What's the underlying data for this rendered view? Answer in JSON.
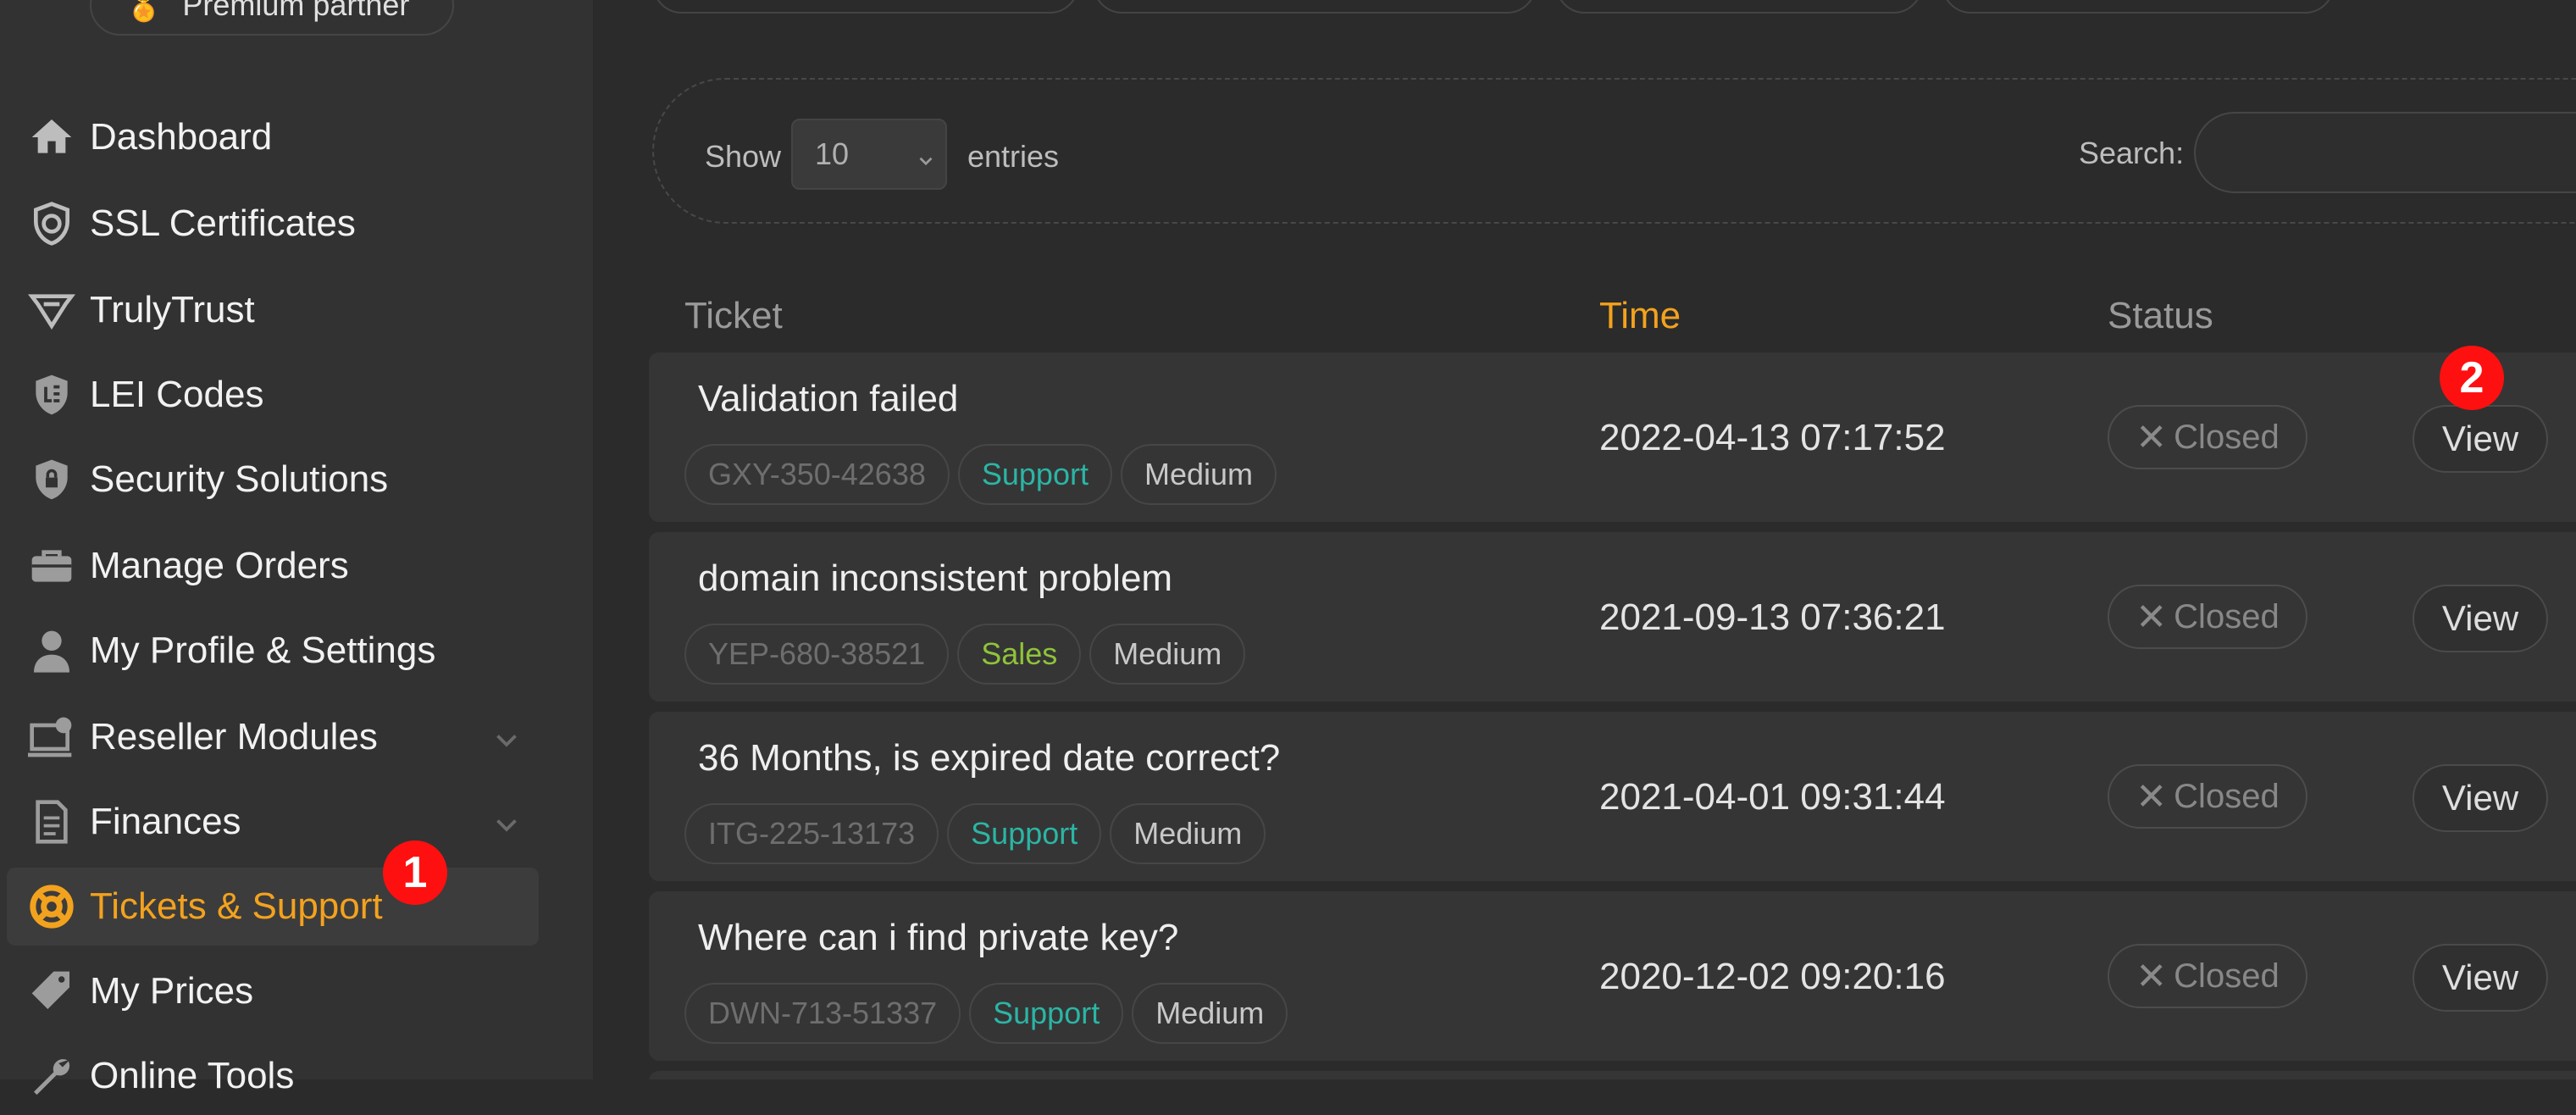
{
  "sidebar": {
    "partner_badge": "Premium partner",
    "items": [
      {
        "label": "Dashboard",
        "icon": "home-icon"
      },
      {
        "label": "SSL Certificates",
        "icon": "ssl-shield-icon"
      },
      {
        "label": "TrulyTrust",
        "icon": "trulytrust-icon"
      },
      {
        "label": "LEI Codes",
        "icon": "lei-shield-icon"
      },
      {
        "label": "Security Solutions",
        "icon": "lock-shield-icon"
      },
      {
        "label": "Manage Orders",
        "icon": "briefcase-icon"
      },
      {
        "label": "My Profile & Settings",
        "icon": "user-icon"
      },
      {
        "label": "Reseller Modules",
        "icon": "modules-icon",
        "expandable": true
      },
      {
        "label": "Finances",
        "icon": "document-icon",
        "expandable": true
      },
      {
        "label": "Tickets & Support",
        "icon": "lifebuoy-icon",
        "active": true
      },
      {
        "label": "My Prices",
        "icon": "price-tag-icon"
      },
      {
        "label": "Online Tools",
        "icon": "wrench-icon"
      }
    ]
  },
  "markers": [
    "1",
    "2"
  ],
  "table_controls": {
    "show_label": "Show",
    "entries_value": "10",
    "entries_label": "entries",
    "search_label": "Search:",
    "search_value": ""
  },
  "columns": {
    "ticket": "Ticket",
    "time": "Time",
    "status": "Status"
  },
  "tickets": [
    {
      "title": "Validation failed",
      "code": "GXY-350-42638",
      "department": "Support",
      "priority": "Medium",
      "time": "2022-04-13 07:17:52",
      "status": "Closed",
      "action": "View"
    },
    {
      "title": "domain inconsistent problem",
      "code": "YEP-680-38521",
      "department": "Sales",
      "priority": "Medium",
      "time": "2021-09-13 07:36:21",
      "status": "Closed",
      "action": "View"
    },
    {
      "title": "36 Months, is expired date correct?",
      "code": "ITG-225-13173",
      "department": "Support",
      "priority": "Medium",
      "time": "2021-04-01 09:31:44",
      "status": "Closed",
      "action": "View"
    },
    {
      "title": "Where can i find private key?",
      "code": "DWN-713-51337",
      "department": "Support",
      "priority": "Medium",
      "time": "2020-12-02 09:20:16",
      "status": "Closed",
      "action": "View"
    }
  ],
  "colors": {
    "accent": "#f3a21e",
    "support_tag": "#2bb5a5",
    "sales_tag": "#8fc33a",
    "marker": "#ff1010"
  }
}
